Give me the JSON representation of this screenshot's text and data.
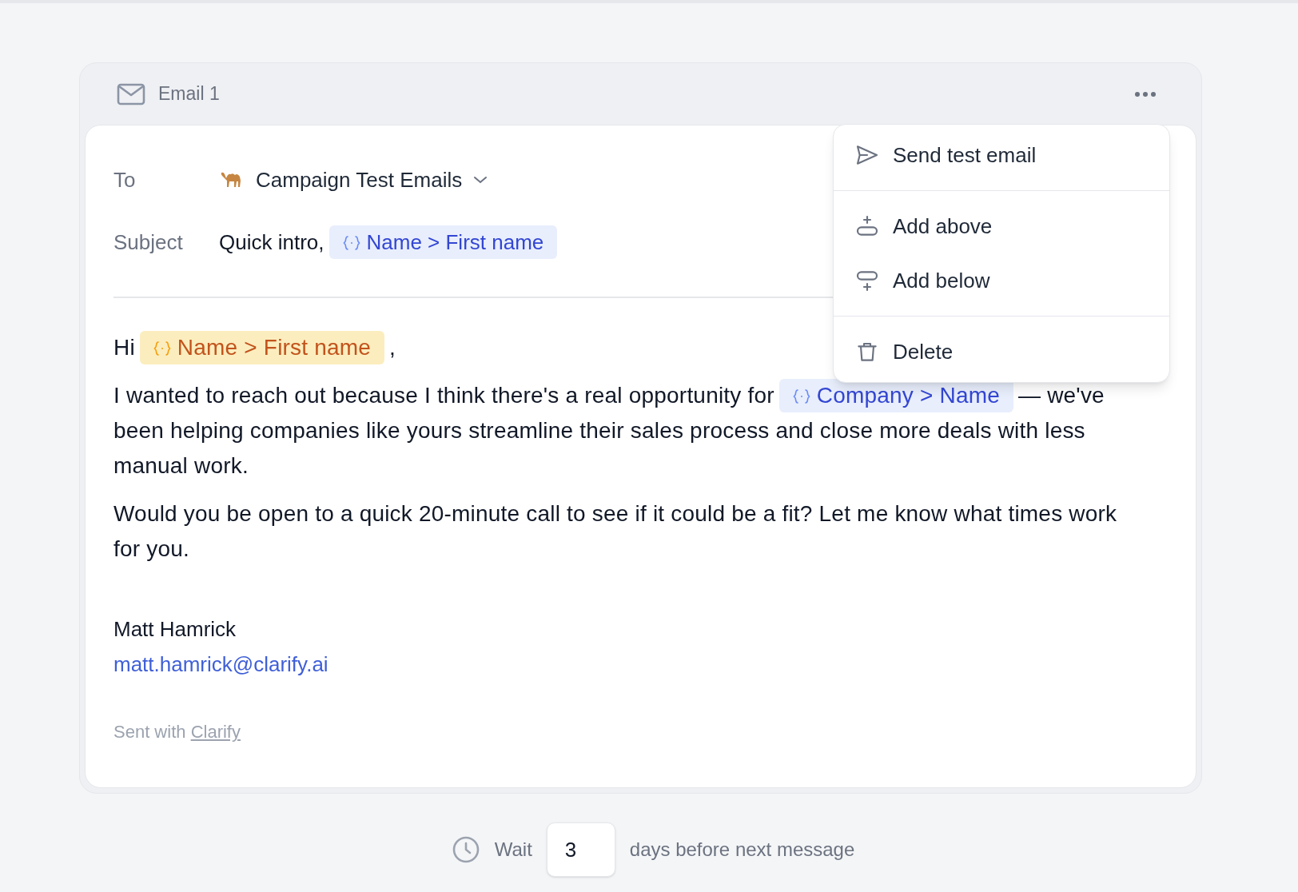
{
  "email": {
    "title": "Email 1",
    "to": {
      "label": "To",
      "value": "Campaign Test Emails"
    },
    "subject": {
      "label": "Subject",
      "parts": [
        {
          "kind": "text",
          "text": "Quick intro,"
        },
        {
          "kind": "variable",
          "text": "Name > First name",
          "highlighted": false
        }
      ]
    },
    "body": [
      {
        "parts": [
          {
            "kind": "text",
            "text": "Hi"
          },
          {
            "kind": "variable",
            "text": "Name > First name",
            "highlighted": true
          },
          {
            "kind": "text",
            "text": ","
          }
        ]
      },
      {
        "parts": [
          {
            "kind": "text",
            "text": "I wanted to reach out because I think there's a real opportunity for"
          },
          {
            "kind": "variable",
            "text": "Company > Name",
            "highlighted": false
          },
          {
            "kind": "text",
            "text": "— we've been helping companies like yours streamline their sales process and close more deals with less manual work."
          }
        ]
      },
      {
        "parts": [
          {
            "kind": "text",
            "text": "Would you be open to a quick 20-minute call to see if it could be a fit? Let me know what times work for you."
          }
        ]
      }
    ],
    "signature": {
      "name": "Matt Hamrick",
      "email": "matt.hamrick@clarify.ai"
    },
    "footer": {
      "text": "Sent with",
      "link": "Clarify"
    }
  },
  "menu": {
    "groups": [
      {
        "items": [
          {
            "kind": "send",
            "label": "Send test email"
          }
        ]
      },
      {
        "items": [
          {
            "kind": "add-above",
            "label": "Add above"
          },
          {
            "kind": "add-below",
            "label": "Add below"
          }
        ]
      },
      {
        "items": [
          {
            "kind": "delete",
            "label": "Delete"
          }
        ]
      }
    ]
  },
  "wait": {
    "prefix": "Wait",
    "value": "3",
    "suffix": "days before next message"
  }
}
